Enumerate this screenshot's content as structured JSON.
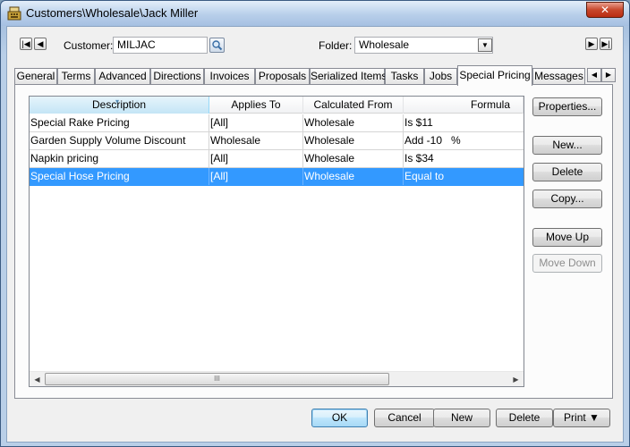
{
  "window": {
    "title": "Customers\\Wholesale\\Jack Miller",
    "close_label": "✕"
  },
  "header": {
    "customer_label": "Customer:",
    "customer_value": "MILJAC",
    "folder_label": "Folder:",
    "folder_value": "Wholesale"
  },
  "tabs": [
    {
      "label": "General"
    },
    {
      "label": "Terms"
    },
    {
      "label": "Advanced"
    },
    {
      "label": "Directions"
    },
    {
      "label": "Invoices"
    },
    {
      "label": "Proposals"
    },
    {
      "label": "Serialized Items"
    },
    {
      "label": "Tasks"
    },
    {
      "label": "Jobs"
    },
    {
      "label": "Special Pricing"
    },
    {
      "label": "Messages"
    }
  ],
  "grid": {
    "columns": [
      "Description",
      "Applies To",
      "Calculated From",
      "Formula"
    ],
    "rows": [
      [
        "Special Rake Pricing",
        "[All]",
        "Wholesale",
        "Is $11"
      ],
      [
        "Garden Supply Volume Discount",
        "Wholesale",
        "Wholesale",
        "Add -10   %"
      ],
      [
        "Napkin pricing",
        "[All]",
        "Wholesale",
        "Is $34"
      ],
      [
        "Special Hose Pricing",
        "[All]",
        "Wholesale",
        "Equal to"
      ]
    ],
    "selected_row": 3,
    "scroll_grip": "III"
  },
  "side_buttons": {
    "properties": "Properties...",
    "new": "New...",
    "delete": "Delete",
    "copy": "Copy...",
    "move_up": "Move Up",
    "move_down": "Move Down"
  },
  "footer_buttons": {
    "ok": "OK",
    "cancel": "Cancel",
    "new": "New",
    "delete": "Delete",
    "print": "Print ▼"
  },
  "colors": {
    "selection": "#3399ff",
    "title_bar": "#b8cfea",
    "close_button": "#c8472c"
  }
}
